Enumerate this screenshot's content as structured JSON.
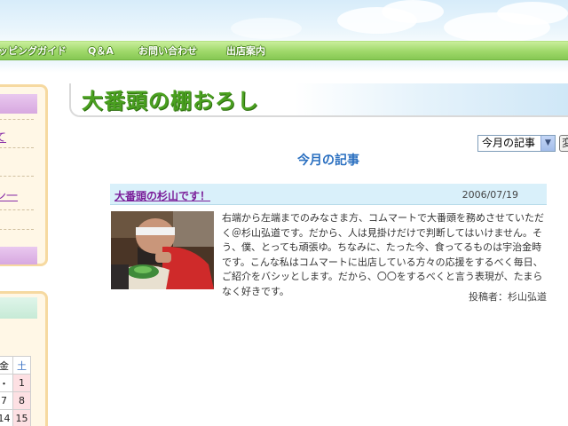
{
  "nav": {
    "items": [
      "ッピングガイド",
      "Q＆A",
      "お問い合わせ",
      "出店案内"
    ]
  },
  "sidebar": {
    "link1": "て",
    "link2": "ン一"
  },
  "calendar": {
    "header": [
      "金",
      "土"
    ],
    "rows": [
      [
        "・",
        "1"
      ],
      [
        "7",
        "8"
      ],
      [
        "14",
        "15"
      ]
    ]
  },
  "page": {
    "title": "大番頭の棚おろし",
    "section_heading": "今月の記事"
  },
  "month_select": {
    "selected": "今月の記事",
    "go_label": "変"
  },
  "article": {
    "title": "大番頭の杉山です！",
    "date": "2006/07/19",
    "body": "右端から左端までのみなさま方、コムマートで大番頭を務めさせていただく＠杉山弘道です。だから、人は見掛けだけで判断してはいけません。そう、僕、とっても頑張ゆ。ちなみに、たった今、食ってるものは宇治金時です。こんな私はコムマートに出店している方々の応援をするべく毎日、ご紹介をバシッとします。だから、〇〇をするべくと言う表現が、たまらなく好きです。",
    "author": "投稿者：杉山弘道"
  },
  "colors": {
    "nav_green": "#9fd86a",
    "title_green": "#4aa020",
    "heading_blue": "#2a6fc0",
    "article_head_bg": "#d9f0fa",
    "link_purple": "#7b1f9a"
  }
}
